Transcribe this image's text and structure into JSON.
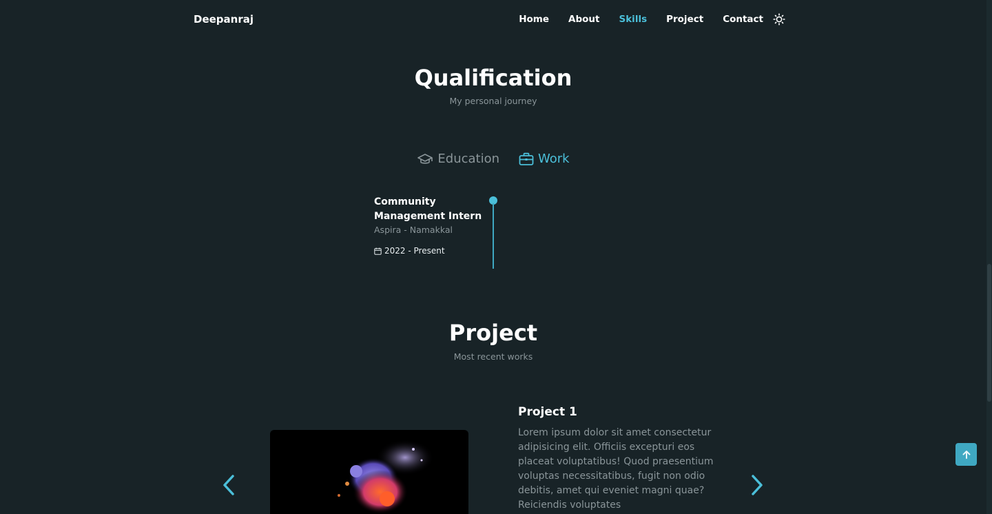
{
  "header": {
    "brand": "Deepanraj",
    "nav": [
      {
        "label": "Home",
        "active": false
      },
      {
        "label": "About",
        "active": false
      },
      {
        "label": "Skills",
        "active": true
      },
      {
        "label": "Project",
        "active": false
      },
      {
        "label": "Contact",
        "active": false
      }
    ],
    "theme_icon": "sun-icon"
  },
  "qualification": {
    "title": "Qualification",
    "subtitle": "My personal journey",
    "tabs": [
      {
        "label": "Education",
        "icon": "graduation-cap-icon",
        "active": false
      },
      {
        "label": "Work",
        "icon": "briefcase-icon",
        "active": true
      }
    ],
    "entries": [
      {
        "title": "Community Management Intern",
        "subtitle": "Aspira - Namakkal",
        "date": "2022 - Present",
        "date_icon": "calendar-icon"
      }
    ]
  },
  "project": {
    "title": "Project",
    "subtitle": "Most recent works",
    "items": [
      {
        "title": "Project 1",
        "description": "Lorem ipsum dolor sit amet consectetur adipisicing elit. Officiis excepturi eos placeat voluptatibus! Quod praesentium voluptas necessitatibus, fugit non odio debitis, amet qui eveniet magni quae? Reiciendis voluptates"
      }
    ],
    "prev_icon": "chevron-left-icon",
    "next_icon": "chevron-right-icon"
  },
  "scroll_up_icon": "arrow-up-icon",
  "colors": {
    "background": "#182327",
    "accent": "#4bbfd9",
    "text": "#ffffff",
    "muted": "#8a9599"
  }
}
